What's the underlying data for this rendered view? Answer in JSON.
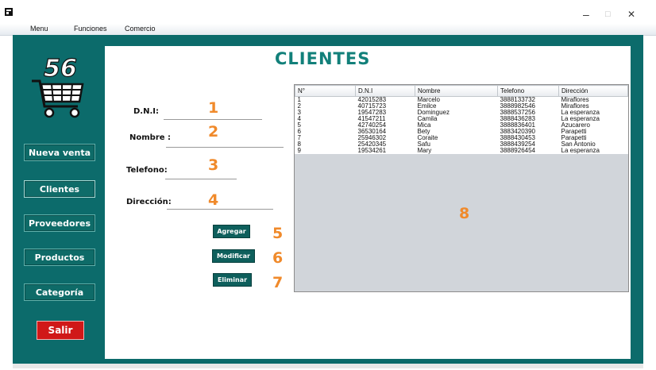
{
  "window": {
    "minimize_glyph": "–",
    "maximize_glyph": "□",
    "close_glyph": "✕"
  },
  "menubar": {
    "items": [
      "Menu",
      "Funciones",
      "Comercio"
    ]
  },
  "sidebar": {
    "logo_number": "56",
    "buttons": [
      "Nueva venta",
      "Clientes",
      "Proveedores",
      "Productos",
      "Categoría"
    ],
    "exit_label": "Salir"
  },
  "main": {
    "title": "CLIENTES",
    "form": {
      "dni_label": "D.N.I:",
      "nombre_label": "Nombre :",
      "telefono_label": "Telefono:",
      "direccion_label": "Dirección:"
    },
    "actions": {
      "add_label": "Agregar",
      "modify_label": "Modificar",
      "delete_label": "Eliminar"
    },
    "annotations": [
      "1",
      "2",
      "3",
      "4",
      "5",
      "6",
      "7",
      "8"
    ],
    "table": {
      "columns": [
        "N°",
        "D.N.I",
        "Nombre",
        "Telefono",
        "Dirección"
      ],
      "rows": [
        [
          "1",
          "42015283",
          "Marcelo",
          "3888133732",
          "Miraflores"
        ],
        [
          "2",
          "40715723",
          "Emilce",
          "3888982546",
          "Miraflores"
        ],
        [
          "3",
          "19547283",
          "Dominguez",
          "3888537256",
          "La esperanza"
        ],
        [
          "4",
          "41547211",
          "Camila",
          "3888436283",
          "La esperanza"
        ],
        [
          "5",
          "42740254",
          "Mica",
          "3888836401",
          "Azucarero"
        ],
        [
          "6",
          "36530164",
          "Bety",
          "3883420390",
          "Parapetti"
        ],
        [
          "7",
          "25946302",
          "Coraite",
          "3888430453",
          "Parapetti"
        ],
        [
          "8",
          "25420345",
          "Safu",
          "3888439254",
          "San Antonio"
        ],
        [
          "9",
          "19534261",
          "Mary",
          "3888926454",
          "La esperanza"
        ]
      ]
    }
  },
  "colors": {
    "accent": "#0c6b6b",
    "title": "#12807a",
    "annotation": "#f08a2b",
    "exit": "#d01818"
  }
}
